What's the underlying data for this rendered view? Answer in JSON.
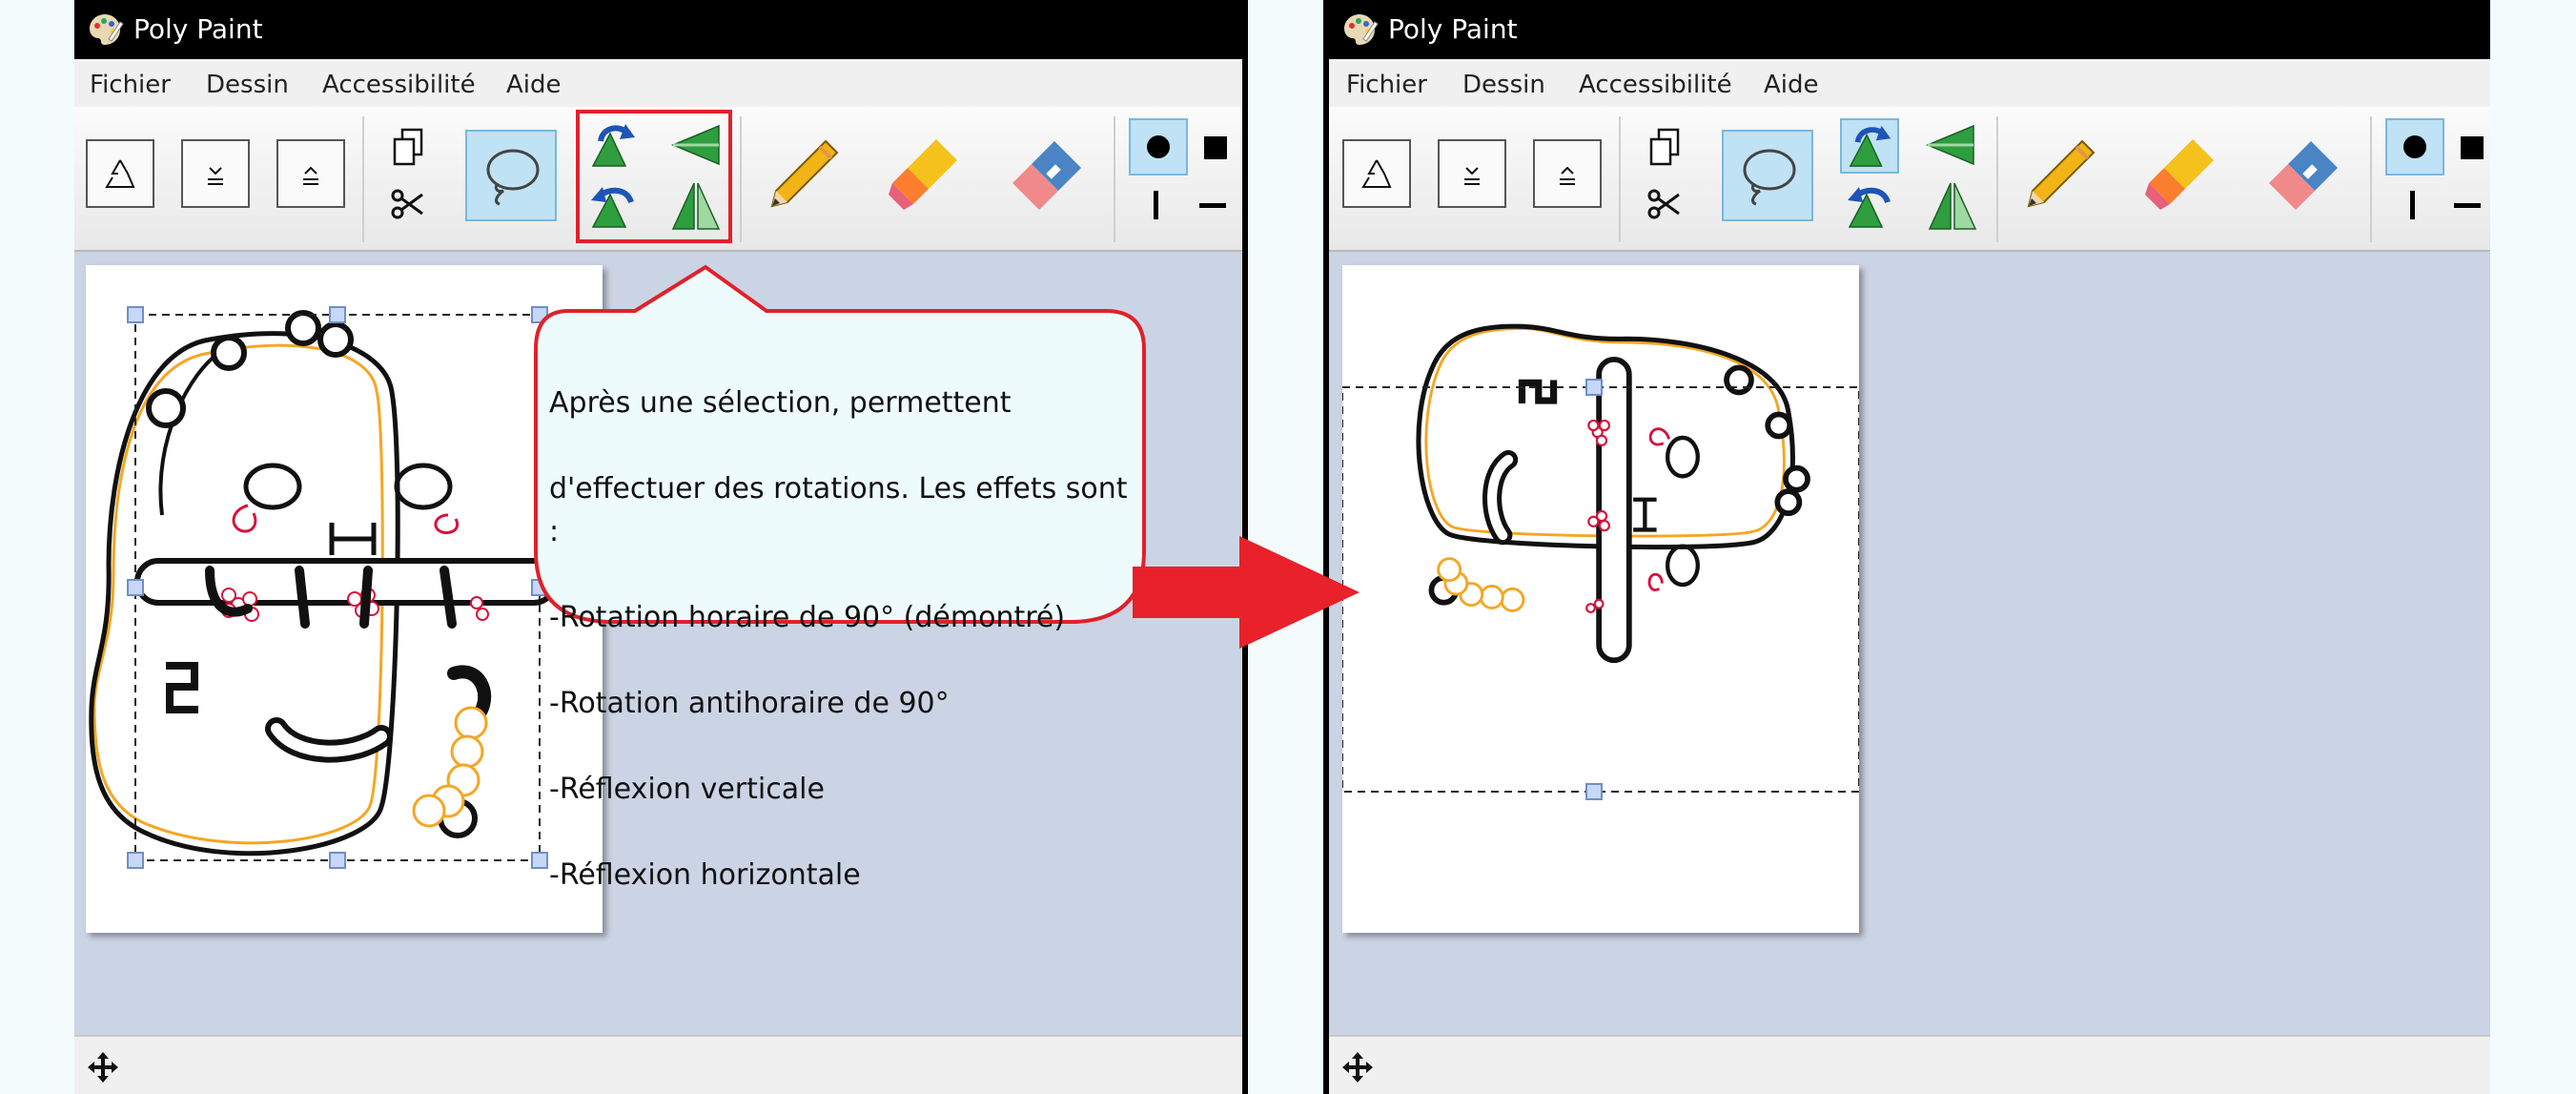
{
  "app": {
    "title": "Poly Paint"
  },
  "menu": {
    "file": "Fichier",
    "draw": "Dessin",
    "accessibility": "Accessibilité",
    "help": "Aide"
  },
  "icons": {
    "app": "palette-icon",
    "undo": "recycle-icon",
    "layer_down": "send-backward-icon",
    "layer_up": "bring-forward-icon",
    "copy": "copy-icon",
    "cut": "scissors-icon",
    "lasso": "lasso-icon",
    "rotate_cw": "rotate-clockwise-icon",
    "rotate_ccw": "rotate-counterclockwise-icon",
    "flip_v": "flip-vertical-icon",
    "flip_h": "flip-horizontal-icon",
    "pencil": "pencil-icon",
    "marker": "highlighter-icon",
    "eraser": "eraser-icon",
    "dot": "round-tip-icon",
    "square": "square-tip-icon",
    "vertical_line": "vertical-tip-icon",
    "horizontal_line": "horizontal-tip-icon",
    "move": "move-icon"
  },
  "annotation": {
    "callout_lines": [
      "Après une sélection, permettent",
      "d'effectuer des rotations. Les effets sont :",
      "-Rotation horaire de 90° (démontré)",
      "-Rotation antihoraire de 90°",
      "-Réflexion verticale",
      "-Réflexion horizontale"
    ]
  },
  "colors": {
    "highlight": "#e0212b",
    "callout_fill": "#eefbfd",
    "selection_handle": "#c7d7f5",
    "drawing_orange": "#f5a623",
    "drawing_red": "#d6123c",
    "canvas_bg": "#cbd4e4"
  }
}
